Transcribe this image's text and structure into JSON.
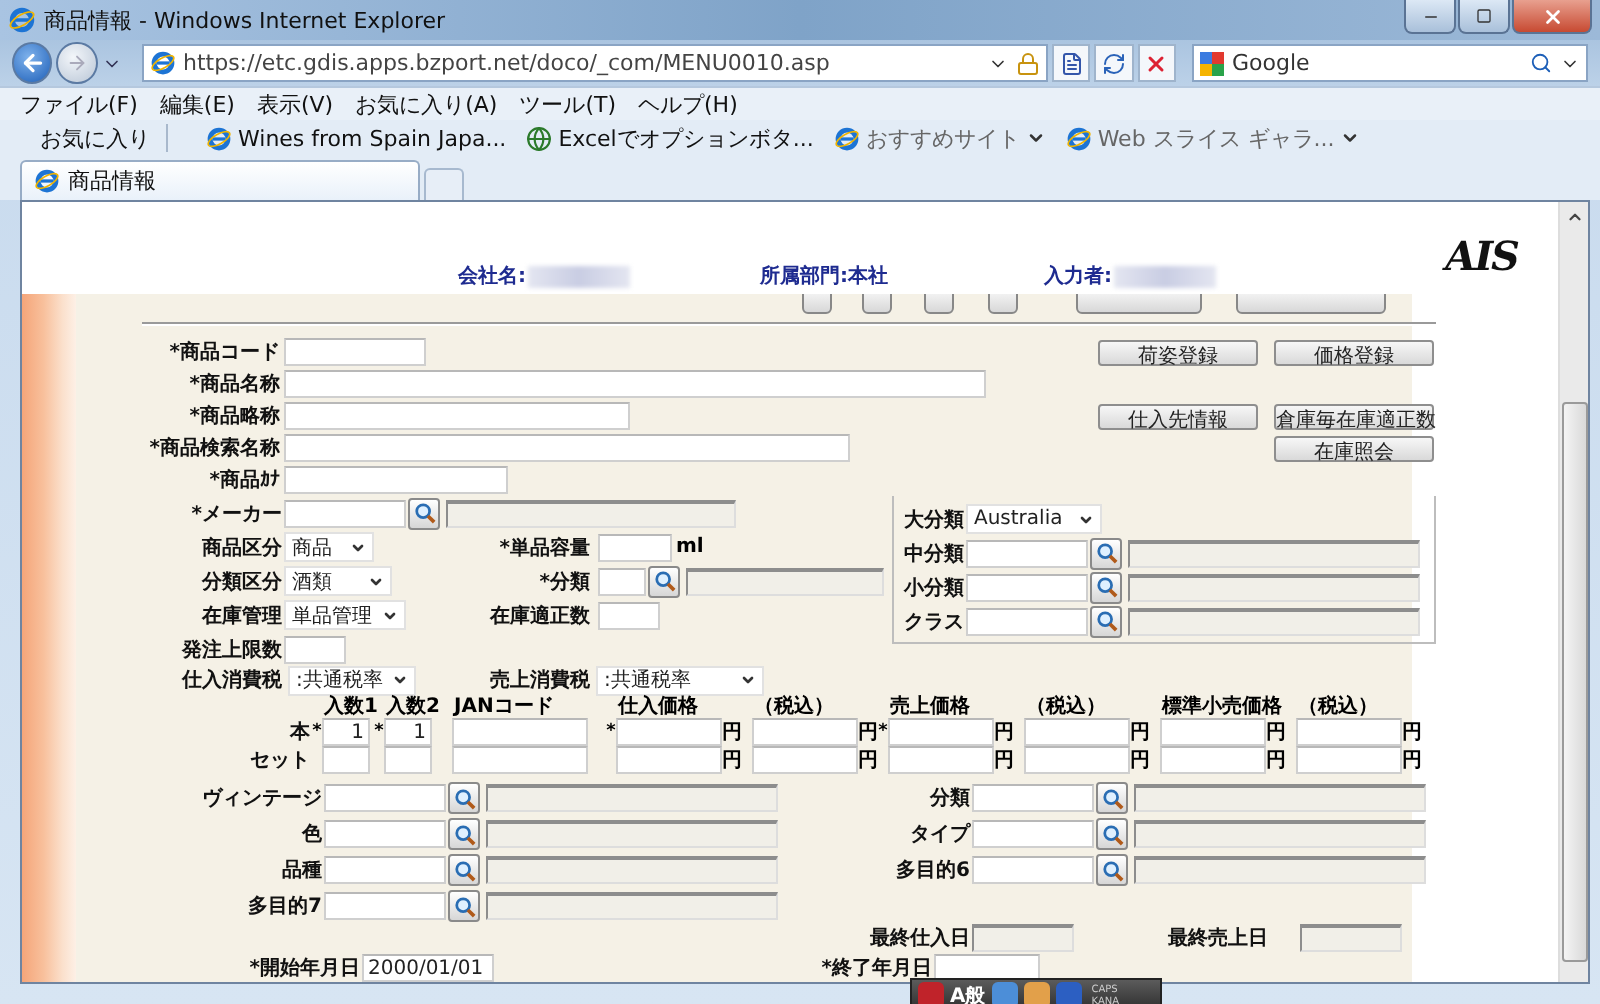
{
  "window": {
    "title": "商品情報 - Windows Internet Explorer"
  },
  "address": {
    "value": "https://etc.gdis.apps.bzport.net/doco/_com/MENU0010.asp"
  },
  "search": {
    "placeholder": "Google"
  },
  "menu": [
    "ファイル(F)",
    "編集(E)",
    "表示(V)",
    "お気に入り(A)",
    "ツール(T)",
    "ヘルプ(H)"
  ],
  "favorites": {
    "label": "お気に入り",
    "links": [
      {
        "label": "Wines from Spain Japa...",
        "kind": "page"
      },
      {
        "label": "Excelでオプションボタ...",
        "kind": "globe"
      },
      {
        "label": "おすすめサイト",
        "kind": "menu"
      },
      {
        "label": "Web スライス ギャラ...",
        "kind": "menu"
      }
    ]
  },
  "tabs": [
    {
      "label": "商品情報",
      "selected": true
    }
  ],
  "header": {
    "fields": [
      {
        "text": "会社名:",
        "redacted": true
      },
      {
        "text": "所属部門:本社",
        "redacted": false
      },
      {
        "text": "入力者:",
        "redacted": true
      }
    ],
    "logo": "AIS"
  },
  "top_fields": [
    {
      "label": "*商品コード"
    },
    {
      "label": "*商品名称"
    },
    {
      "label": "*商品略称"
    },
    {
      "label": "*商品検索名称"
    },
    {
      "label": "*商品ｶﾅ"
    }
  ],
  "action_buttons": [
    "荷姿登録",
    "価格登録",
    "仕入先情報",
    "倉庫毎在庫適正数",
    "在庫照会"
  ],
  "maker": {
    "label": "*メーカー"
  },
  "attributes": [
    {
      "label": "商品区分",
      "value": "商品"
    },
    {
      "label": "分類区分",
      "value": "酒類"
    },
    {
      "label": "在庫管理",
      "value": "単品管理"
    }
  ],
  "unit_volume": {
    "label": "*単品容量",
    "unit": "ml"
  },
  "category": {
    "label": "*分類"
  },
  "stock_optimal": {
    "label": "在庫適正数"
  },
  "order_limit": {
    "label": "発注上限数"
  },
  "classification": {
    "major": {
      "label": "大分類",
      "value": "Australia"
    },
    "lookups": [
      {
        "label": "中分類"
      },
      {
        "label": "小分類"
      },
      {
        "label": "クラス"
      }
    ]
  },
  "tax": [
    {
      "label": "仕入消費税",
      "value": ":共通税率"
    },
    {
      "label": "売上消費税",
      "value": ":共通税率"
    }
  ],
  "prices": {
    "columns": [
      "入数1",
      "入数2",
      "JANコード",
      "仕入価格",
      "（税込）",
      "売上価格",
      "（税込）",
      "標準小売価格",
      "（税込）"
    ],
    "rows": [
      {
        "label": "本",
        "cells": [
          {
            "kind": "qty",
            "mark": "*",
            "value": "1"
          },
          {
            "kind": "qty",
            "mark": "*",
            "value": "1"
          },
          {
            "kind": "jan"
          },
          {
            "kind": "price",
            "mark": "*",
            "unit": "円"
          },
          {
            "kind": "price",
            "unit": "円"
          },
          {
            "kind": "price",
            "mark": "*",
            "unit": "円"
          },
          {
            "kind": "price",
            "unit": "円"
          },
          {
            "kind": "price",
            "unit": "円"
          },
          {
            "kind": "price",
            "unit": "円"
          }
        ]
      },
      {
        "label": "セット",
        "cells": [
          {
            "kind": "qty"
          },
          {
            "kind": "qty"
          },
          {
            "kind": "jan"
          },
          {
            "kind": "price",
            "unit": "円"
          },
          {
            "kind": "price",
            "unit": "円"
          },
          {
            "kind": "price",
            "unit": "円"
          },
          {
            "kind": "price",
            "unit": "円"
          },
          {
            "kind": "price",
            "unit": "円"
          },
          {
            "kind": "price",
            "unit": "円"
          }
        ]
      }
    ]
  },
  "lookups_left": [
    {
      "label": "ヴィンテージ"
    },
    {
      "label": "色"
    },
    {
      "label": "品種"
    },
    {
      "label": "多目的7"
    }
  ],
  "lookups_right": [
    {
      "label": "分類"
    },
    {
      "label": "タイプ"
    },
    {
      "label": "多目的6"
    }
  ],
  "last_dates": [
    {
      "label": "最終仕入日"
    },
    {
      "label": "最終売上日"
    }
  ],
  "period": [
    {
      "label": "*開始年月日",
      "value": "2000/01/01"
    },
    {
      "label": "*終了年月日"
    }
  ],
  "ime_bar": {
    "mode": "A般",
    "indicators": [
      "CAPS",
      "KANA"
    ]
  }
}
